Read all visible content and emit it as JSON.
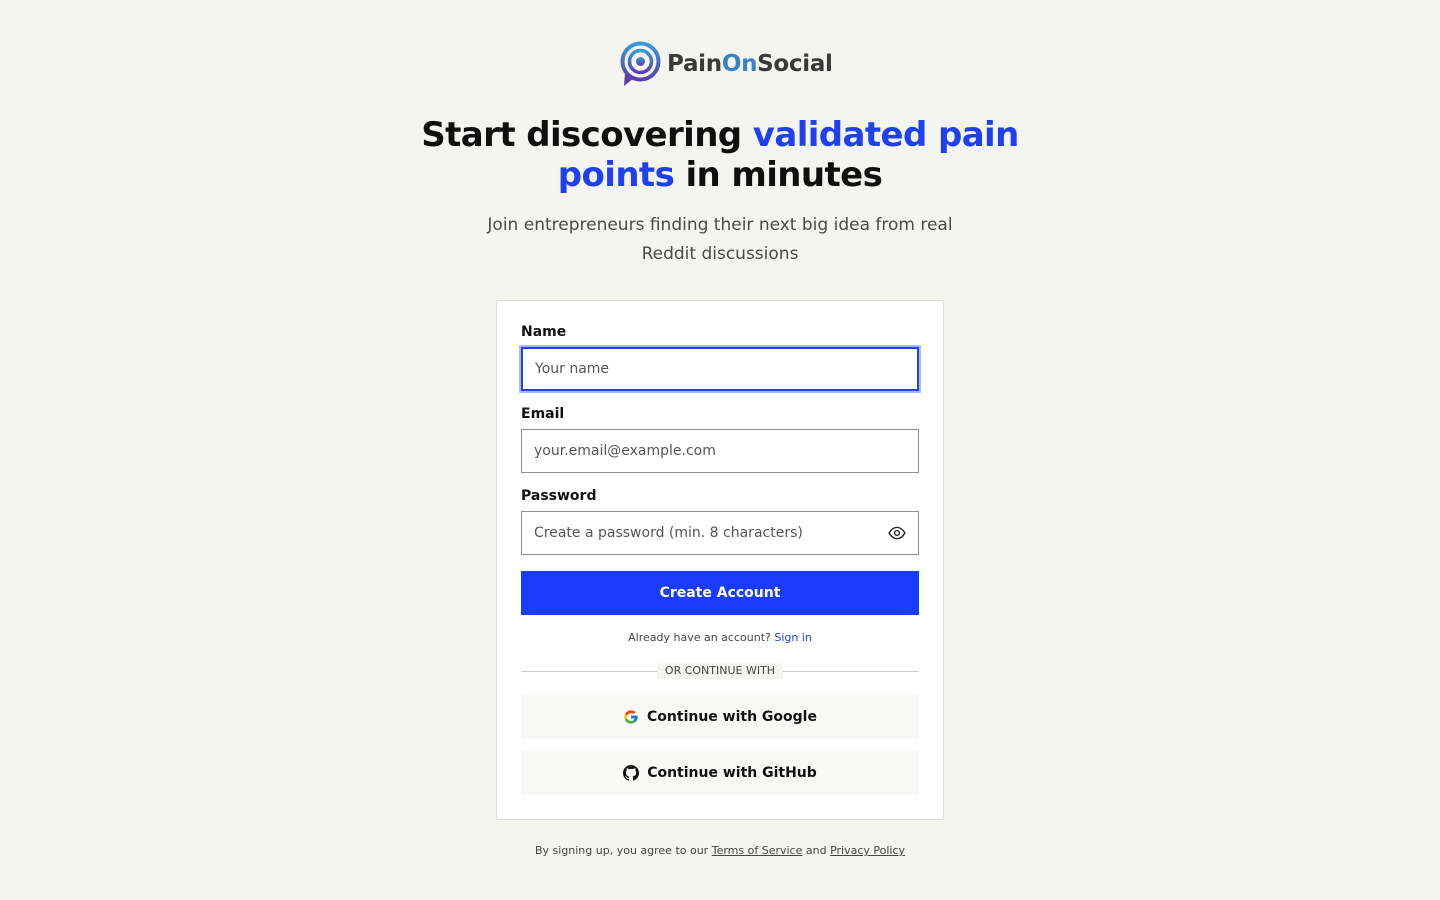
{
  "brand": {
    "name_part1": "Pain",
    "name_part2": "On",
    "name_part3": "Social",
    "accent_color": "#1e40f0",
    "logo_icon": "target-chat-bubble-icon"
  },
  "hero": {
    "headline_part1": "Start discovering ",
    "headline_accent": "validated pain points",
    "headline_part2": " in minutes",
    "subheadline": "Join entrepreneurs finding their next big idea from real Reddit discussions"
  },
  "form": {
    "name_label": "Name",
    "name_placeholder": "Your name",
    "name_value": "",
    "email_label": "Email",
    "email_placeholder": "your.email@example.com",
    "email_value": "",
    "password_label": "Password",
    "password_placeholder": "Create a password (min. 8 characters)",
    "password_value": "",
    "submit_label": "Create Account",
    "already_text": "Already have an account?",
    "signin_link": "Sign in",
    "divider_text": "OR CONTINUE WITH",
    "google_label": "Continue with Google",
    "github_label": "Continue with GitHub"
  },
  "footer": {
    "prefix": "By signing up, you agree to our",
    "terms_link": "Terms of Service",
    "and_text": "and",
    "privacy_link": "Privacy Policy"
  }
}
